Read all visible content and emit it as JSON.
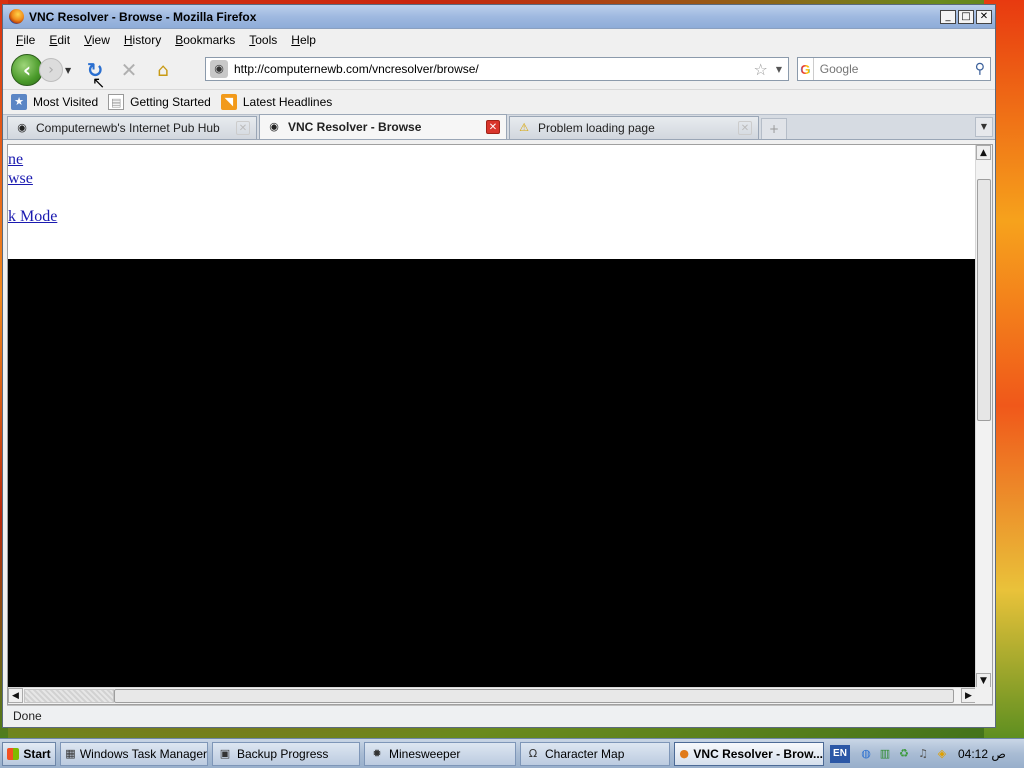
{
  "window": {
    "title": "VNC Resolver - Browse - Mozilla Firefox",
    "controls": {
      "minimize": "_",
      "maximize": "□",
      "close": "✕"
    }
  },
  "menu": [
    "File",
    "Edit",
    "View",
    "History",
    "Bookmarks",
    "Tools",
    "Help"
  ],
  "nav": {
    "url": "http://computernewb.com/vncresolver/browse/",
    "search_placeholder": "Google"
  },
  "bookmarks": [
    {
      "label": "Most Visited",
      "icon": "most-visited-icon"
    },
    {
      "label": "Getting Started",
      "icon": "page-icon"
    },
    {
      "label": "Latest Headlines",
      "icon": "rss-icon"
    }
  ],
  "tabs": [
    {
      "label": "Computernewb's Internet Pub Hub",
      "icon": "site-icon",
      "active": false
    },
    {
      "label": "VNC Resolver - Browse",
      "icon": "site-icon",
      "active": true
    },
    {
      "label": "Problem loading page",
      "icon": "warning-icon",
      "active": false
    }
  ],
  "page": {
    "links": [
      "ne",
      "wse",
      "k Mode"
    ]
  },
  "status": "Done",
  "taskbar": {
    "start": "Start",
    "tasks": [
      {
        "label": "Windows Task Manager",
        "icon": "task-manager-icon"
      },
      {
        "label": "Backup Progress",
        "icon": "backup-icon"
      },
      {
        "label": "Minesweeper",
        "icon": "minesweeper-icon"
      },
      {
        "label": "Character Map",
        "icon": "character-map-icon"
      },
      {
        "label": "VNC Resolver - Brow...",
        "icon": "firefox-icon"
      }
    ],
    "language": "EN",
    "clock": "04:12 ص"
  },
  "colors": {
    "link": "#1a1ab0",
    "canvas": "#000000",
    "close_tab_active": "#d9352b"
  }
}
